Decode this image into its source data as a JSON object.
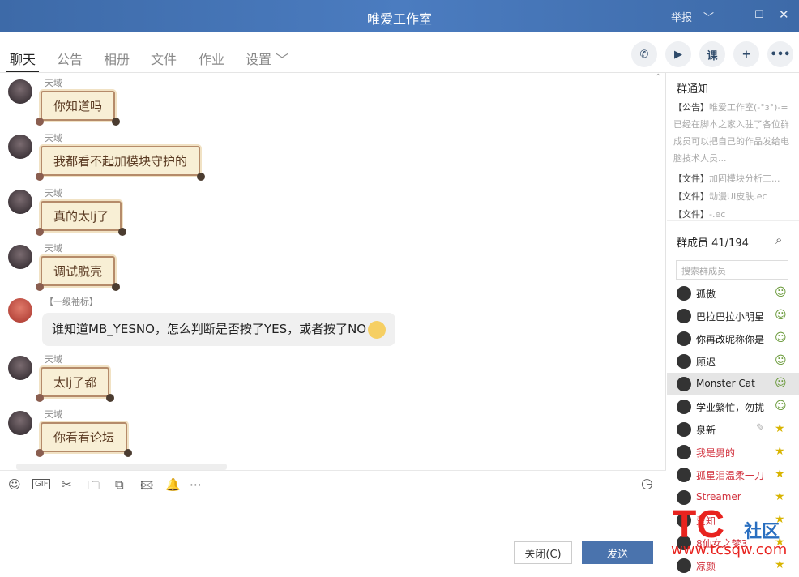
{
  "window": {
    "title": "唯爱工作室",
    "report": "举报",
    "chevron": "﹀",
    "minimize": "—",
    "maximize": "☐",
    "close": "✕"
  },
  "tabs": [
    {
      "label": "聊天",
      "active": true
    },
    {
      "label": "公告",
      "dot": true
    },
    {
      "label": "相册"
    },
    {
      "label": "文件"
    },
    {
      "label": "作业",
      "dot": true
    },
    {
      "label": "设置 ﹀"
    }
  ],
  "header_buttons": [
    {
      "icon": "phone-icon",
      "glyph": "✆"
    },
    {
      "icon": "video-icon",
      "glyph": "▶"
    },
    {
      "icon": "course-icon",
      "glyph": "课"
    },
    {
      "icon": "add-chat-icon",
      "glyph": "+"
    },
    {
      "icon": "more-icon",
      "glyph": "•••"
    }
  ],
  "messages": [
    {
      "sender": "天域",
      "text": "你知道吗",
      "style": "scroll"
    },
    {
      "sender": "天域",
      "text": "我都看不起加模块守护的",
      "style": "scroll"
    },
    {
      "sender": "天域",
      "text": "真的太lj了",
      "style": "scroll"
    },
    {
      "sender": "天域",
      "text": "调试脱壳",
      "style": "scroll"
    },
    {
      "sender": "【一级袖标】",
      "text": "谁知道MB_YESNO，怎么判断是否按了YES，或者按了NO",
      "style": "plain"
    },
    {
      "sender": "天域",
      "text": "太lj了都",
      "style": "scroll"
    },
    {
      "sender": "天域",
      "text": "你看看论坛",
      "style": "scroll"
    }
  ],
  "toolbar": [
    {
      "icon": "emoji-icon",
      "glyph": "☺"
    },
    {
      "icon": "gif-icon",
      "glyph": "GIF"
    },
    {
      "icon": "scissors-icon",
      "glyph": "✂"
    },
    {
      "icon": "folder-icon",
      "glyph": "🗀"
    },
    {
      "icon": "image-edit-icon",
      "glyph": "⧉"
    },
    {
      "icon": "image-icon",
      "glyph": "🖾"
    },
    {
      "icon": "bell-icon",
      "glyph": "🔔"
    },
    {
      "icon": "more-icon",
      "glyph": "⋯"
    }
  ],
  "history_icon": "◷",
  "buttons": {
    "close": "关闭(C)",
    "send": "发送"
  },
  "sidebar": {
    "notice_title": "群通知",
    "notices": [
      {
        "tag": "【公告】",
        "text": "唯爱工作室(-°з°)-=已经在脚本之家入驻了各位群成员可以把自己的作品发给电脑技术人员..."
      },
      {
        "tag": "【文件】",
        "text": "加固模块分析工..."
      },
      {
        "tag": "【文件】",
        "text": "动漫UI皮肤.ec"
      },
      {
        "tag": "【文件】",
        "text": "-.ec"
      }
    ],
    "members_title": "群成员 41/194",
    "search_placeholder": "搜索群成员",
    "members": [
      {
        "name": "孤傲",
        "color": "#222",
        "badge": "member"
      },
      {
        "name": "巴拉巴拉小明星",
        "color": "#222",
        "badge": "member"
      },
      {
        "name": "你再改昵称你是",
        "color": "#222",
        "badge": "member"
      },
      {
        "name": "顾迟",
        "color": "#222",
        "badge": "member"
      },
      {
        "name": "Monster Cat",
        "color": "#222",
        "badge": "member",
        "selected": true
      },
      {
        "name": "学业繁忙，勿扰",
        "color": "#222",
        "badge": "member"
      },
      {
        "name": "泉新一",
        "color": "#222",
        "badge": "admin",
        "edit": true
      },
      {
        "name": "我是男的",
        "color": "#d2333f",
        "badge": "admin"
      },
      {
        "name": "孤星泪温柔一刀",
        "color": "#d2333f",
        "badge": "admin"
      },
      {
        "name": "Streamer",
        "color": "#d2333f",
        "badge": "admin"
      },
      {
        "name": "爱知",
        "color": "#d2333f",
        "badge": "admin"
      },
      {
        "name": "8仙女之梦3",
        "color": "#d2333f",
        "badge": "admin"
      },
      {
        "name": "凉颜",
        "color": "#d2333f",
        "badge": "admin"
      }
    ]
  },
  "watermark": {
    "logo": "TC",
    "text": "社区",
    "url": "www.tcsqw.com"
  },
  "colors": {
    "titlebar": "#4574b5",
    "send": "#4a73ad",
    "admin_name": "#d2333f"
  }
}
